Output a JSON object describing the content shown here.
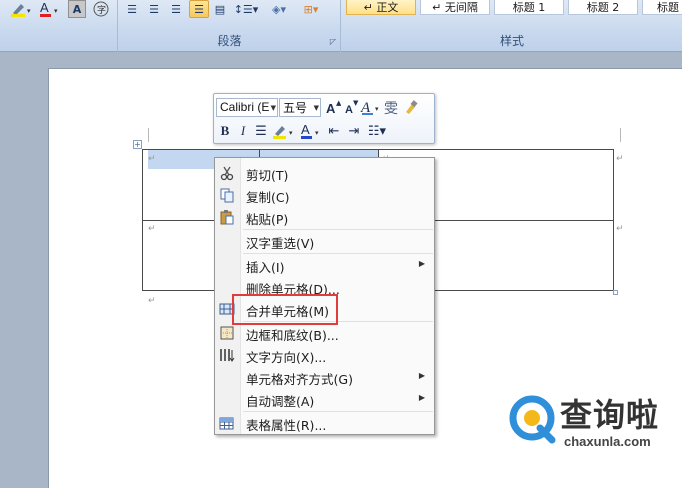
{
  "ribbon": {
    "groups": {
      "paragraph_label": "段落",
      "styles_label": "样式"
    },
    "styles": [
      {
        "label": "↵ 正文",
        "selected": true
      },
      {
        "label": "↵ 无间隔",
        "selected": false
      },
      {
        "label": "标题 1",
        "selected": false
      },
      {
        "label": "标题 2",
        "selected": false
      },
      {
        "label": "标题",
        "selected": false
      }
    ]
  },
  "mini_toolbar": {
    "font_name": "Calibri (E",
    "font_size": "五号"
  },
  "context_menu": {
    "items": [
      {
        "label": "剪切(T)",
        "icon": "scissors-icon"
      },
      {
        "label": "复制(C)",
        "icon": "copy-icon"
      },
      {
        "label": "粘贴(P)",
        "icon": "paste-icon"
      },
      {
        "label": "汉字重选(V)",
        "icon": ""
      },
      {
        "label": "插入(I)",
        "icon": "",
        "submenu": true
      },
      {
        "label": "删除单元格(D)...",
        "icon": ""
      },
      {
        "label": "合并单元格(M)",
        "icon": "merge-cells-icon",
        "highlighted": true
      },
      {
        "label": "边框和底纹(B)...",
        "icon": "borders-icon"
      },
      {
        "label": "文字方向(X)...",
        "icon": "text-direction-icon"
      },
      {
        "label": "单元格对齐方式(G)",
        "icon": "",
        "submenu": true
      },
      {
        "label": "自动调整(A)",
        "icon": "",
        "submenu": true
      },
      {
        "label": "表格属性(R)...",
        "icon": "table-properties-icon"
      }
    ]
  },
  "watermark": {
    "name": "查询啦",
    "url": "chaxunla.com"
  },
  "colors": {
    "highlight_box": "#e13c3c",
    "watermark_blue": "#2f8fd8"
  }
}
